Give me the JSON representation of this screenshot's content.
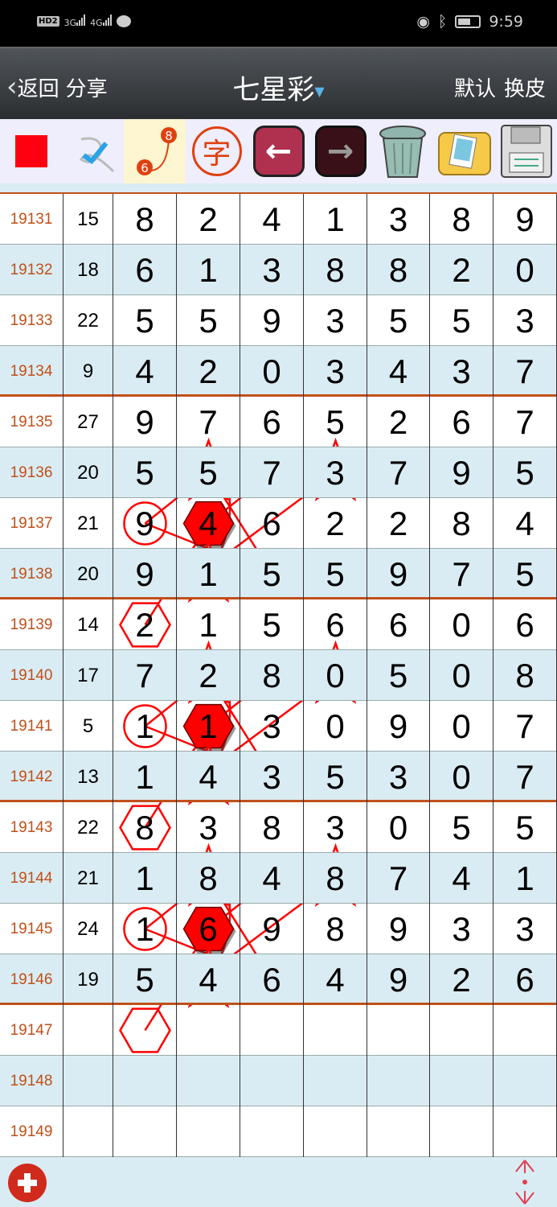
{
  "status_bar": {
    "left": [
      "HD2",
      "3G",
      "4G"
    ],
    "time": "9:59",
    "icons": [
      "eye-icon",
      "bluetooth-icon",
      "battery-icon"
    ]
  },
  "header": {
    "back_label": "返回",
    "share_label": "分享",
    "title": "七星彩",
    "default_label": "默认",
    "skin_label": "换皮"
  },
  "toolbar": {
    "icons": [
      "red-square-icon",
      "check-icon",
      "connect-6-8-icon",
      "character-icon",
      "back-arrow-icon",
      "forward-arrow-icon",
      "trash-icon",
      "photo-folder-icon",
      "save-disk-icon"
    ],
    "connect_nums": [
      "6",
      "8"
    ],
    "char_label": "字"
  },
  "colors": {
    "accent": "#ff0000",
    "issue": "#c0501a",
    "alt_row": "#daecf3",
    "separator": "#c0501a"
  },
  "rows": [
    {
      "issue": "19131",
      "sum": "15",
      "digits": [
        "8",
        "2",
        "4",
        "1",
        "3",
        "8",
        "9"
      ]
    },
    {
      "issue": "19132",
      "sum": "18",
      "digits": [
        "6",
        "1",
        "3",
        "8",
        "8",
        "2",
        "0"
      ]
    },
    {
      "issue": "19133",
      "sum": "22",
      "digits": [
        "5",
        "5",
        "9",
        "3",
        "5",
        "5",
        "3"
      ]
    },
    {
      "issue": "19134",
      "sum": "9",
      "digits": [
        "4",
        "2",
        "0",
        "3",
        "4",
        "3",
        "7"
      ]
    },
    {
      "issue": "19135",
      "sum": "27",
      "digits": [
        "9",
        "7",
        "6",
        "5",
        "2",
        "6",
        "7"
      ]
    },
    {
      "issue": "19136",
      "sum": "20",
      "digits": [
        "5",
        "5",
        "7",
        "3",
        "7",
        "9",
        "5"
      ]
    },
    {
      "issue": "19137",
      "sum": "21",
      "digits": [
        "9",
        "4",
        "6",
        "2",
        "2",
        "8",
        "4"
      ]
    },
    {
      "issue": "19138",
      "sum": "20",
      "digits": [
        "9",
        "1",
        "5",
        "5",
        "9",
        "7",
        "5"
      ]
    },
    {
      "issue": "19139",
      "sum": "14",
      "digits": [
        "2",
        "1",
        "5",
        "6",
        "6",
        "0",
        "6"
      ]
    },
    {
      "issue": "19140",
      "sum": "17",
      "digits": [
        "7",
        "2",
        "8",
        "0",
        "5",
        "0",
        "8"
      ]
    },
    {
      "issue": "19141",
      "sum": "5",
      "digits": [
        "1",
        "1",
        "3",
        "0",
        "9",
        "0",
        "7"
      ]
    },
    {
      "issue": "19142",
      "sum": "13",
      "digits": [
        "1",
        "4",
        "3",
        "5",
        "3",
        "0",
        "7"
      ]
    },
    {
      "issue": "19143",
      "sum": "22",
      "digits": [
        "8",
        "3",
        "8",
        "3",
        "0",
        "5",
        "5"
      ]
    },
    {
      "issue": "19144",
      "sum": "21",
      "digits": [
        "1",
        "8",
        "4",
        "8",
        "7",
        "4",
        "1"
      ]
    },
    {
      "issue": "19145",
      "sum": "24",
      "digits": [
        "1",
        "6",
        "9",
        "8",
        "9",
        "3",
        "3"
      ]
    },
    {
      "issue": "19146",
      "sum": "19",
      "digits": [
        "5",
        "4",
        "6",
        "4",
        "9",
        "2",
        "6"
      ]
    },
    {
      "issue": "19147",
      "sum": "",
      "digits": [
        "",
        "",
        "",
        "",
        "",
        "",
        ""
      ]
    },
    {
      "issue": "19148",
      "sum": "",
      "digits": [
        "",
        "",
        "",
        "",
        "",
        "",
        ""
      ]
    },
    {
      "issue": "19149",
      "sum": "",
      "digits": [
        "",
        "",
        "",
        "",
        "",
        "",
        ""
      ]
    }
  ],
  "marks": [
    [
      "19136",
      1,
      "star"
    ],
    [
      "19136",
      1,
      "circle"
    ],
    [
      "19136",
      2,
      "hex"
    ],
    [
      "19136",
      3,
      "hex-filled"
    ],
    [
      "19136",
      3,
      "star"
    ],
    [
      "19136",
      4,
      "hex-filled"
    ],
    [
      "19137",
      0,
      "circle"
    ],
    [
      "19137",
      1,
      "hex-filled"
    ],
    [
      "19138",
      0,
      "hex-filled"
    ],
    [
      "19138",
      1,
      "star"
    ],
    [
      "19138",
      2,
      "circle"
    ],
    [
      "19138",
      3,
      "hex-filled"
    ],
    [
      "19139",
      0,
      "hex"
    ],
    [
      "19140",
      1,
      "star"
    ],
    [
      "19140",
      1,
      "circle"
    ],
    [
      "19140",
      2,
      "hex"
    ],
    [
      "19140",
      3,
      "hex-filled"
    ],
    [
      "19140",
      3,
      "star"
    ],
    [
      "19140",
      4,
      "hex-filled"
    ],
    [
      "19141",
      0,
      "circle"
    ],
    [
      "19141",
      1,
      "hex-filled"
    ],
    [
      "19142",
      0,
      "hex-filled"
    ],
    [
      "19142",
      1,
      "star"
    ],
    [
      "19142",
      2,
      "circle"
    ],
    [
      "19142",
      3,
      "hex-filled"
    ],
    [
      "19143",
      0,
      "hex"
    ],
    [
      "19144",
      1,
      "star"
    ],
    [
      "19144",
      1,
      "circle"
    ],
    [
      "19144",
      2,
      "hex"
    ],
    [
      "19144",
      3,
      "hex-filled"
    ],
    [
      "19144",
      3,
      "star"
    ],
    [
      "19144",
      4,
      "hex-filled"
    ],
    [
      "19145",
      0,
      "circle"
    ],
    [
      "19145",
      1,
      "hex-filled"
    ],
    [
      "19146",
      0,
      "hex-filled"
    ],
    [
      "19146",
      1,
      "star"
    ],
    [
      "19146",
      2,
      "circle"
    ],
    [
      "19146",
      3,
      "hex-filled"
    ],
    [
      "19147",
      0,
      "hex"
    ]
  ],
  "bottom": {
    "add_icon": "add-icon",
    "scroll_icon": "up-down-arrows-icon"
  }
}
